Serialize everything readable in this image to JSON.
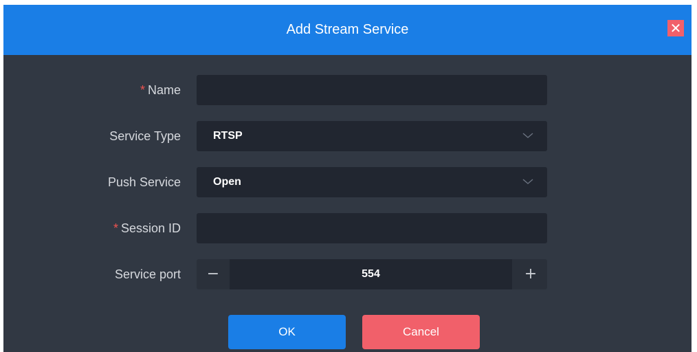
{
  "dialog": {
    "title": "Add Stream Service",
    "close_glyph": "✕",
    "close_icon": "close-icon"
  },
  "form": {
    "name": {
      "label": "Name",
      "required_mark": "*",
      "value": ""
    },
    "service_type": {
      "label": "Service Type",
      "value": "RTSP",
      "icon": "chevron-down-icon"
    },
    "push_service": {
      "label": "Push Service",
      "value": "Open",
      "icon": "chevron-down-icon"
    },
    "session_id": {
      "label": "Session ID",
      "required_mark": "*",
      "value": ""
    },
    "service_port": {
      "label": "Service port",
      "value": "554",
      "minus_glyph": "−",
      "plus_glyph": "+"
    }
  },
  "buttons": {
    "ok": "OK",
    "cancel": "Cancel"
  },
  "colors": {
    "accent": "#1a7ee6",
    "danger": "#f1606a",
    "dialog_bg": "#313843",
    "input_bg": "#212630",
    "required": "#ef5350"
  }
}
